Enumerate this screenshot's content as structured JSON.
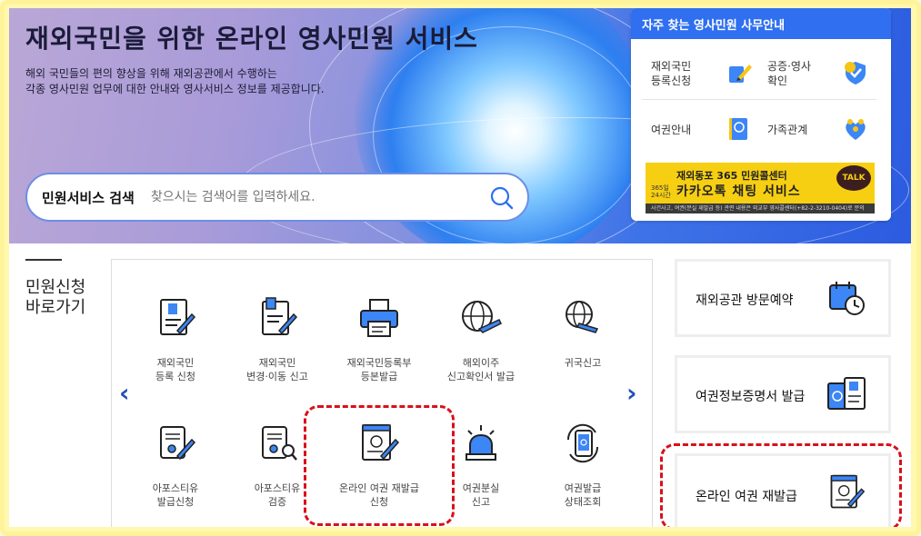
{
  "hero": {
    "title": "재외국민을 위한 온라인 영사민원 서비스",
    "desc_line1": "해외 국민들의 편의 향상을 위해 재외공관에서 수행하는",
    "desc_line2": "각종 영사민원 업무에 대한 안내와 영사서비스 정보를 제공합니다."
  },
  "search": {
    "label": "민원서비스 검색",
    "placeholder": "찾으시는 검색어를 입력하세요."
  },
  "quick": {
    "title": "자주 찾는 영사민원 사무안내",
    "items": [
      {
        "line1": "재외국민",
        "line2": "등록신청"
      },
      {
        "line1": "공증·영사",
        "line2": "확인"
      },
      {
        "line1": "여권안내",
        "line2": ""
      },
      {
        "line1": "가족관계",
        "line2": ""
      }
    ],
    "banner": {
      "line1": "재외동포 365 민원콜센터",
      "small": "365일 24시간",
      "line2": "카카오톡 채팅 서비스",
      "talk": "TALK",
      "bottom": "사건사고, 여권(분실 재발급 등) 관련 내용은 외교부 영사콜센터(+82-2-3210-0404)로 문의"
    }
  },
  "shortcut": {
    "title_line1": "민원신청",
    "title_line2": "바로가기"
  },
  "services": [
    {
      "line1": "재외국민",
      "line2": "등록 신청",
      "icon": "registration-form-icon"
    },
    {
      "line1": "재외국민",
      "line2": "변경·이동 신고",
      "icon": "document-edit-icon"
    },
    {
      "line1": "재외국민등록부",
      "line2": "등본발급",
      "icon": "printer-icon"
    },
    {
      "line1": "해외이주",
      "line2": "신고확인서 발급",
      "icon": "globe-plane-icon"
    },
    {
      "line1": "귀국신고",
      "line2": "",
      "icon": "globe-plane-return-icon"
    },
    {
      "line1": "아포스티유",
      "line2": "발급신청",
      "icon": "scroll-pen-icon"
    },
    {
      "line1": "아포스티유",
      "line2": "검증",
      "icon": "scroll-search-icon"
    },
    {
      "line1": "온라인 여권 재발급",
      "line2": "신청",
      "icon": "passport-form-icon"
    },
    {
      "line1": "여권분실",
      "line2": "신고",
      "icon": "siren-icon"
    },
    {
      "line1": "여권발급",
      "line2": "상태조회",
      "icon": "phone-passport-icon"
    }
  ],
  "side_cards": [
    {
      "label": "재외공관 방문예약",
      "icon": "calendar-clock-icon"
    },
    {
      "label": "여권정보증명서 발급",
      "icon": "passport-certificate-icon"
    },
    {
      "label": "온라인 여권 재발급",
      "icon": "passport-form-icon"
    }
  ],
  "colors": {
    "accent": "#2f6ff0",
    "highlight": "#d8101a",
    "banner": "#f7cf12"
  }
}
